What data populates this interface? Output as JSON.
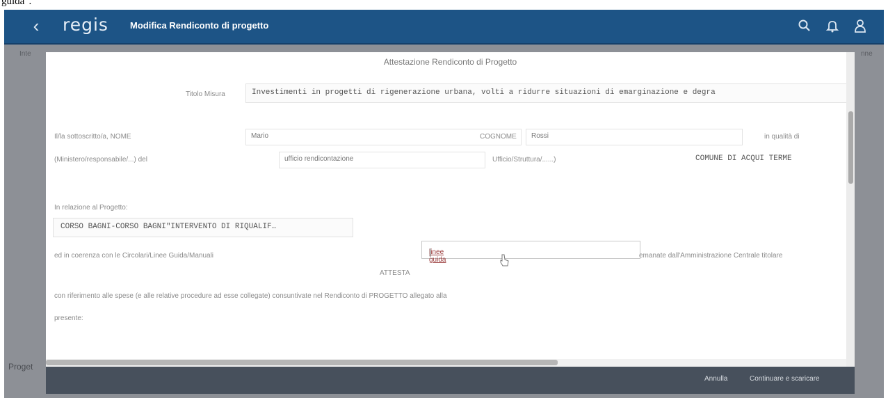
{
  "page_top_fragment": "guida\".",
  "header": {
    "back_icon": "chevron-left-icon",
    "logo": "regis",
    "title": "Modifica Rendiconto di progetto",
    "icons": [
      "search-icon",
      "bell-icon",
      "user-icon"
    ],
    "bg_color": "#1d5486"
  },
  "backdrop": {
    "left_fragment": "Inte",
    "right_fragment": "nne",
    "bottom_left_fragment": "Proget"
  },
  "modal": {
    "title": "Attestazione Rendiconto di Progetto",
    "tipo_label": "Titolo Misura",
    "tipo_value": "Investimenti in progetti di rigenerazione urbana, volti a ridurre situazioni di emarginazione e degra",
    "row1": {
      "label": "Il/la sottoscritto/a, NOME",
      "nome_value": "Mario",
      "cognome_label": "COGNOME",
      "cognome_value": "Rossi",
      "qualita_label": "in qualità di"
    },
    "row2": {
      "label": "(Ministero/responsabile/...) del",
      "ufficio_value": "ufficio rendicontazione",
      "struttura_label": "Ufficio/Struttura/......)",
      "comune_value": "COMUNE DI ACQUI TERME"
    },
    "progetto_label": "In relazione al Progetto:",
    "progetto_value": "CORSO BAGNI-CORSO BAGNI\"INTERVENTO DI RIQUALIF…",
    "coerenza_label": "ed in coerenza con le Circolari/Linee Guida/Manuali",
    "linee_guida_value": "linee guida",
    "emanate_label": "emanate dall'Amministrazione Centrale titolare",
    "attesta_label": "ATTESTA",
    "riferimento_text": "con riferimento alle spese (e alle relative procedure ad esse collegate) consuntivate nel Rendiconto di PROGETTO allegato alla",
    "presente_text": "presente:"
  },
  "footer": {
    "annulla_label": "Annulla",
    "continua_label": "Continuare e scaricare"
  }
}
